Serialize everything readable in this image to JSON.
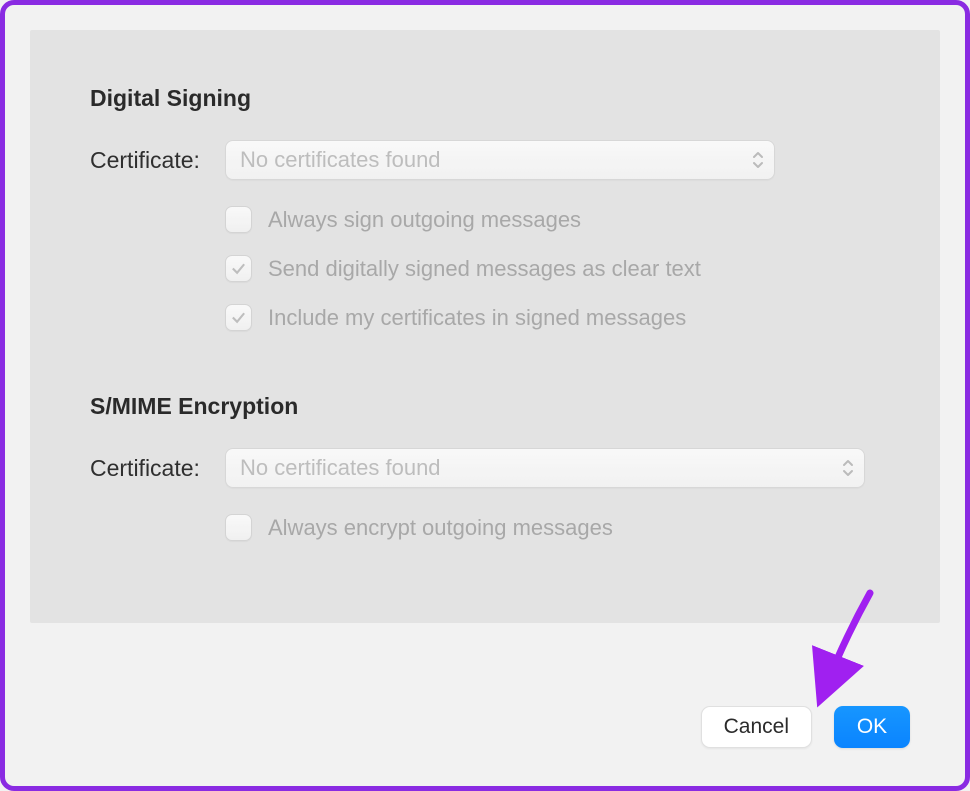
{
  "signing": {
    "heading": "Digital Signing",
    "certificate_label": "Certificate:",
    "certificate_value": "No certificates found",
    "options": [
      {
        "label": "Always sign outgoing messages",
        "checked": false
      },
      {
        "label": "Send digitally signed messages as clear text",
        "checked": true
      },
      {
        "label": "Include my certificates in signed messages",
        "checked": true
      }
    ]
  },
  "encryption": {
    "heading": "S/MIME Encryption",
    "certificate_label": "Certificate:",
    "certificate_value": "No certificates found",
    "options": [
      {
        "label": "Always encrypt outgoing messages",
        "checked": false
      }
    ]
  },
  "buttons": {
    "cancel": "Cancel",
    "ok": "OK"
  }
}
